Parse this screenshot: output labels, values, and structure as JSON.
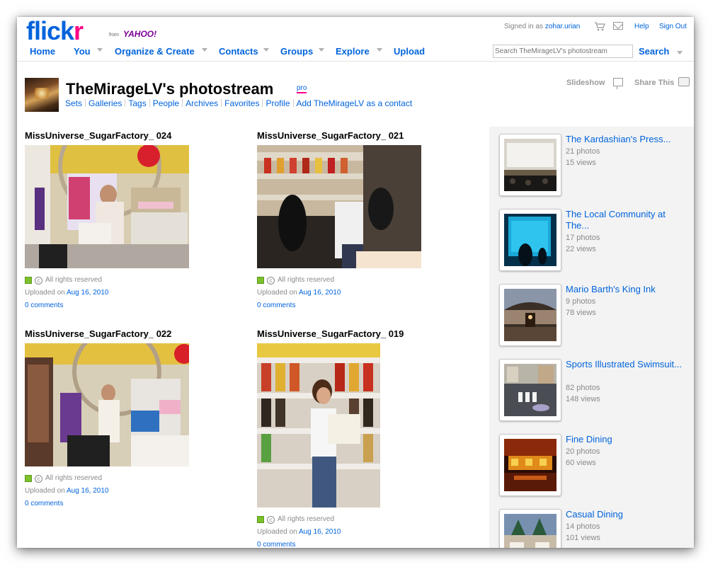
{
  "logo": {
    "flickr": "flick",
    "flickr_r": "r",
    "from": "from",
    "yahoo": "YAHOO!"
  },
  "account": {
    "signed_in_prefix": "Signed in as",
    "username": "zohar.urian",
    "help": "Help",
    "sign_out": "Sign Out"
  },
  "nav": {
    "home": "Home",
    "you": "You",
    "organize": "Organize & Create",
    "contacts": "Contacts",
    "groups": "Groups",
    "explore": "Explore",
    "upload": "Upload"
  },
  "search": {
    "placeholder": "Search TheMirageLV's photostream",
    "button": "Search"
  },
  "profile": {
    "title": "TheMirageLV's photostream",
    "pro": "pro",
    "links": {
      "sets": "Sets",
      "galleries": "Galleries",
      "tags": "Tags",
      "people": "People",
      "archives": "Archives",
      "favorites": "Favorites",
      "profile": "Profile",
      "add_contact": "Add TheMirageLV as a contact"
    },
    "slideshow": "Slideshow",
    "share": "Share This"
  },
  "photos": [
    {
      "title": "MissUniverse_SugarFactory_ 024",
      "rights": "All rights reserved",
      "uploaded_prefix": "Uploaded on",
      "date": "Aug 16, 2010",
      "comments": "0 comments"
    },
    {
      "title": "MissUniverse_SugarFactory_ 021",
      "rights": "All rights reserved",
      "uploaded_prefix": "Uploaded on",
      "date": "Aug 16, 2010",
      "comments": "0 comments"
    },
    {
      "title": "MissUniverse_SugarFactory_ 022",
      "rights": "All rights reserved",
      "uploaded_prefix": "Uploaded on",
      "date": "Aug 16, 2010",
      "comments": "0 comments"
    },
    {
      "title": "MissUniverse_SugarFactory_ 019",
      "rights": "All rights reserved",
      "uploaded_prefix": "Uploaded on",
      "date": "Aug 16, 2010",
      "comments": "0 comments"
    }
  ],
  "sets": [
    {
      "title": "The Kardashian's Press...",
      "count": "21 photos",
      "views": "15 views"
    },
    {
      "title": "The Local Community at The...",
      "count": "17 photos",
      "views": "22 views"
    },
    {
      "title": "Mario Barth's King Ink",
      "count": "9 photos",
      "views": "78 views"
    },
    {
      "title": "Sports Illustrated Swimsuit...",
      "count": "82 photos",
      "views": "148 views"
    },
    {
      "title": "Fine Dining",
      "count": "20 photos",
      "views": "60 views"
    },
    {
      "title": "Casual Dining",
      "count": "14 photos",
      "views": "101 views"
    }
  ],
  "colors": {
    "link": "#0063dc",
    "brand_pink": "#ff0084",
    "license_green": "#7cc12c",
    "sidebar_bg": "#f3f3f3"
  }
}
